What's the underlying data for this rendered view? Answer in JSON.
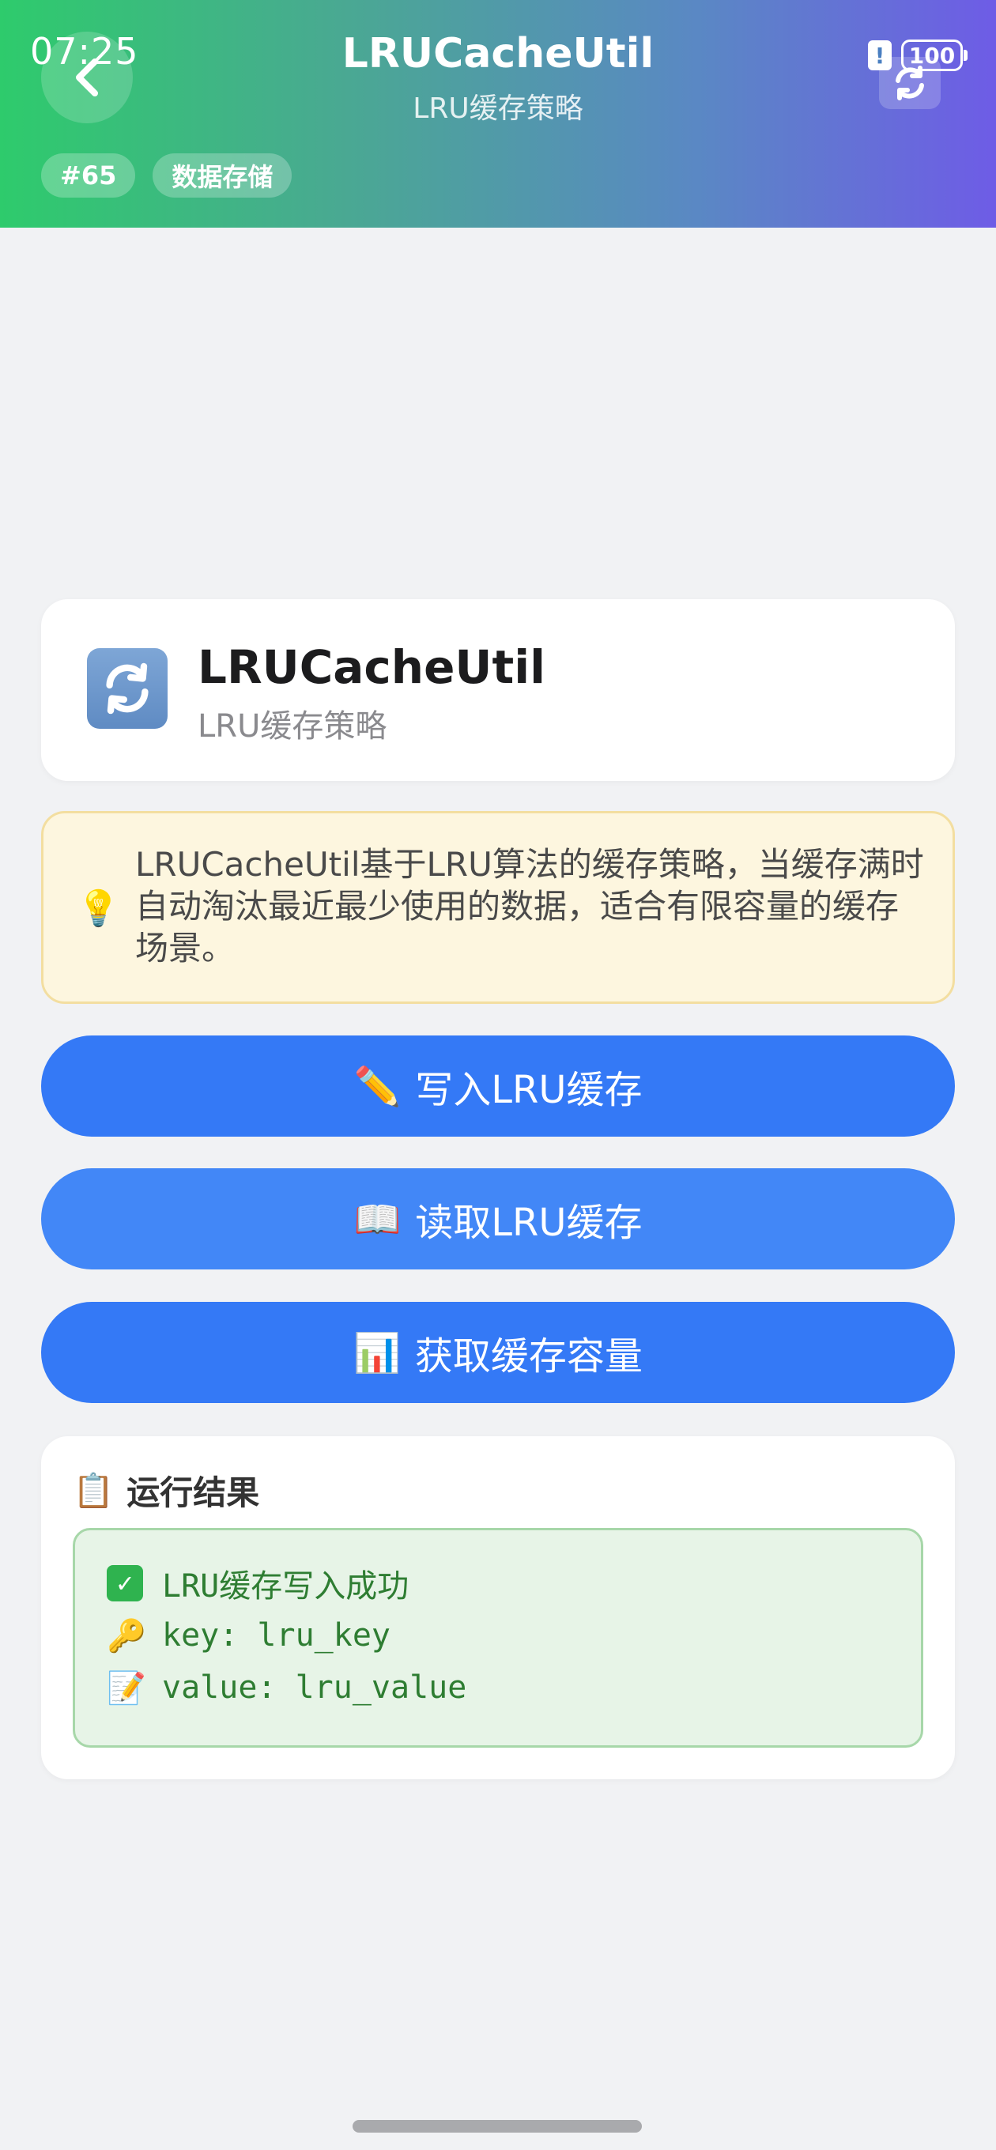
{
  "status_bar": {
    "time": "07:25",
    "battery": "100",
    "alert_icon": "alert-icon"
  },
  "header": {
    "title": "LRUCacheUtil",
    "subtitle": "LRU缓存策略",
    "tags": [
      "#65",
      "数据存储"
    ],
    "back_icon": "chevron-left-icon",
    "refresh_icon": "refresh-icon",
    "gradient": [
      "#2ecb6c",
      "#6e5ce6"
    ]
  },
  "info_card": {
    "title": "LRUCacheUtil",
    "subtitle": "LRU缓存策略",
    "icon": "refresh-icon"
  },
  "tip": {
    "icon": "💡",
    "text": "LRUCacheUtil基于LRU算法的缓存策略，当缓存满时自动淘汰最近最少使用的数据，适合有限容量的缓存场景。"
  },
  "actions": [
    {
      "emoji": "✏️",
      "label": "写入LRU缓存"
    },
    {
      "emoji": "📖",
      "label": "读取LRU缓存"
    },
    {
      "emoji": "📊",
      "label": "获取缓存容量"
    }
  ],
  "result": {
    "header_emoji": "📋",
    "header": "运行结果",
    "lines": [
      {
        "emoji": "✓",
        "text": "LRU缓存写入成功"
      },
      {
        "emoji": "🔑",
        "text": "key: lru_key"
      },
      {
        "emoji": "📝",
        "text": "value: lru_value"
      }
    ]
  },
  "colors": {
    "primary_button": "#3479f6",
    "tip_background": "#fdf6df",
    "result_background": "#e7f4e7",
    "result_text": "#2e7d32"
  }
}
